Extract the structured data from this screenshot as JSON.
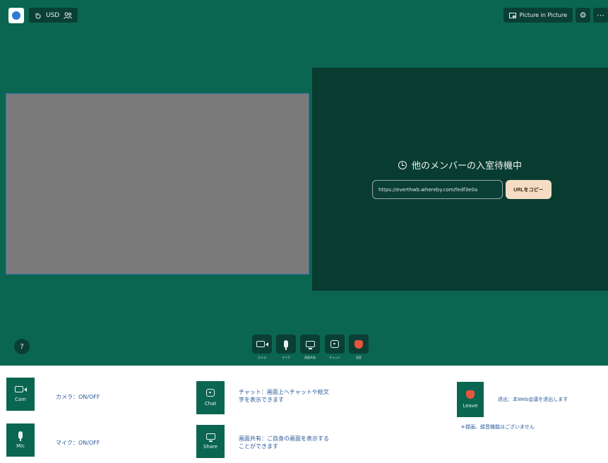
{
  "topbar": {
    "usage_label": "USD",
    "pip_label": "Picture in Picture"
  },
  "waiting": {
    "title": "他のメンバーの入室待機中",
    "url_value": "https://everthwb.whereby.com/fedf3e0a",
    "copy_label": "URLをコピー"
  },
  "controls": {
    "help_label": "?",
    "items": [
      {
        "label": "カメラ"
      },
      {
        "label": "マイク"
      },
      {
        "label": "画面共有"
      },
      {
        "label": "チャット"
      },
      {
        "label": "退室"
      }
    ]
  },
  "legend": {
    "cam": {
      "tile": "Cam",
      "text": "カメラ：ON/OFF"
    },
    "mic": {
      "tile": "Mic",
      "text": "マイク：ON/OFF"
    },
    "chat": {
      "tile": "Chat",
      "text1": "チャット：画面上へチャットや絵文",
      "text2": "字を表示できます"
    },
    "share": {
      "tile": "Share",
      "text1": "画面共有：ご自身の画面を表示する",
      "text2": "ことができます"
    },
    "leave": {
      "tile": "Leave",
      "text": "退出：本Web会議を退出します",
      "note": "＊録画、録音機能はございません"
    }
  },
  "colors": {
    "background": "#0b6651",
    "panel": "#083c31",
    "button_dark": "#0a3f35",
    "copy_button": "#f6dcc5",
    "leave_accent": "#e8553e",
    "legend_text": "#2a5a9a"
  }
}
